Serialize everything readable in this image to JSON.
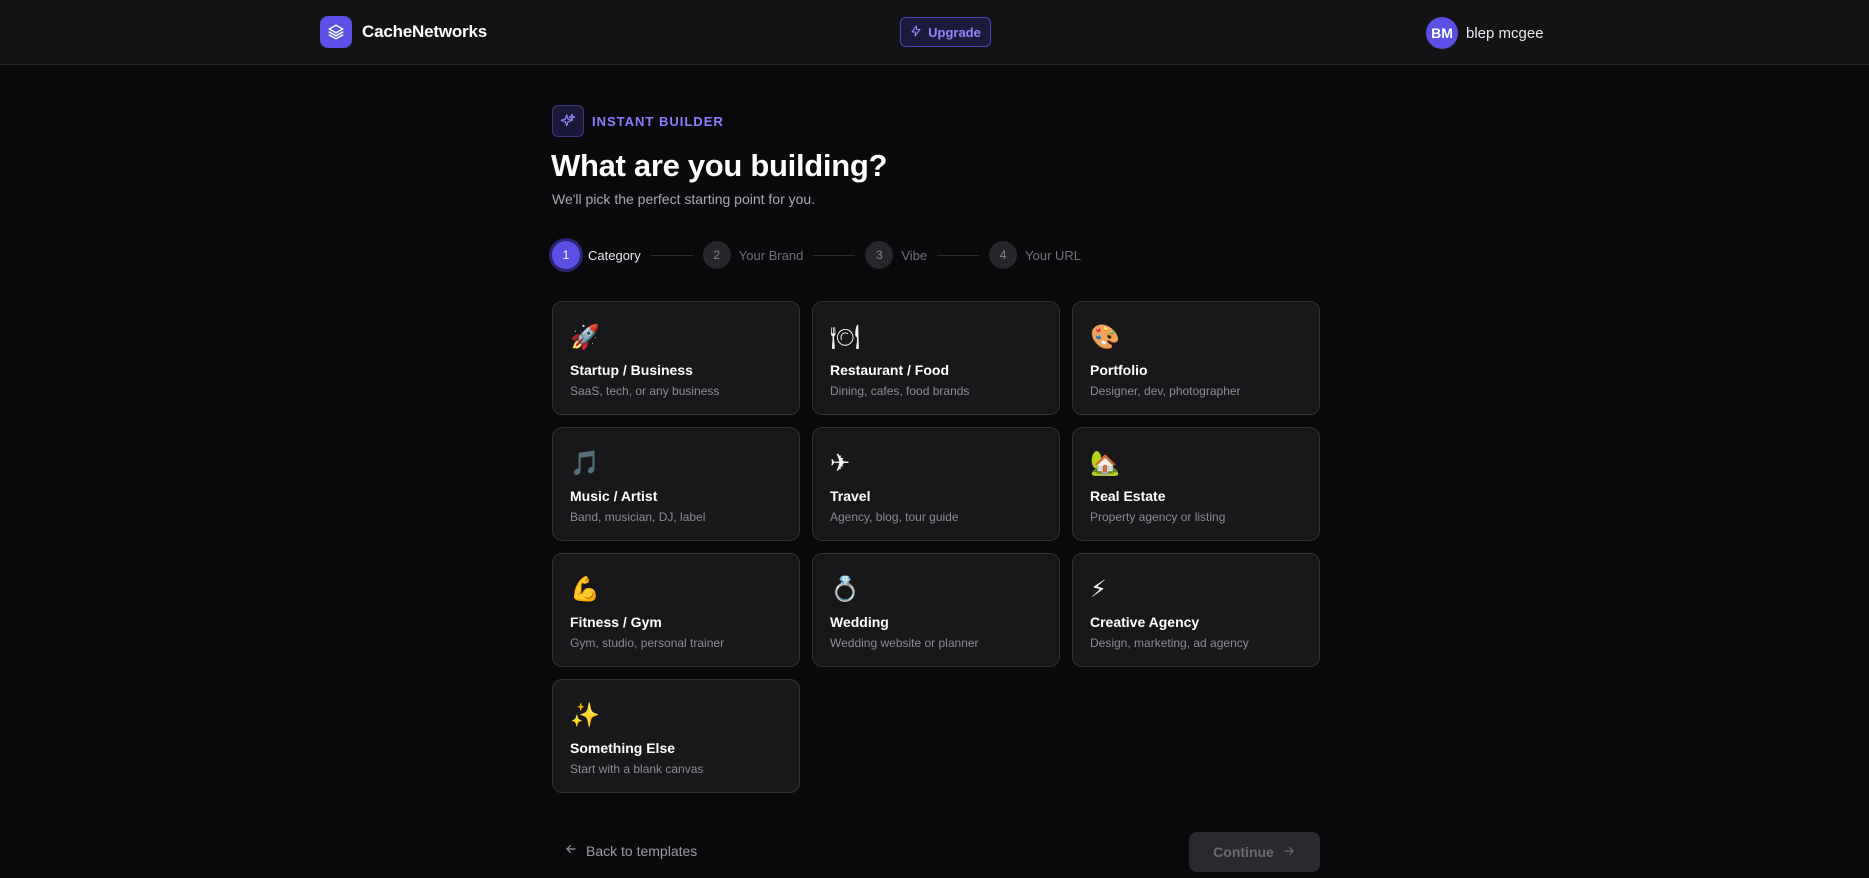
{
  "header": {
    "brand_name": "CacheNetworks",
    "logo_icon": "layers-icon",
    "upgrade_label": "Upgrade",
    "upgrade_icon": "lightning-icon",
    "user_initials": "BM",
    "user_name": "blep mcgee"
  },
  "builder": {
    "badge_icon": "sparkles-icon",
    "badge_label": "INSTANT BUILDER",
    "title": "What are you building?",
    "subtitle": "We'll pick the perfect starting point for you."
  },
  "steps": [
    {
      "number": "1",
      "label": "Category",
      "active": true
    },
    {
      "number": "2",
      "label": "Your Brand",
      "active": false
    },
    {
      "number": "3",
      "label": "Vibe",
      "active": false
    },
    {
      "number": "4",
      "label": "Your URL",
      "active": false
    }
  ],
  "categories": [
    {
      "icon": "🚀",
      "icon_name": "rocket-icon",
      "title": "Startup / Business",
      "description": "SaaS, tech, or any business"
    },
    {
      "icon": "🍽",
      "icon_name": "plate-icon",
      "title": "Restaurant / Food",
      "description": "Dining, cafes, food brands"
    },
    {
      "icon": "🎨",
      "icon_name": "palette-icon",
      "title": "Portfolio",
      "description": "Designer, dev, photographer"
    },
    {
      "icon": "🎵",
      "icon_name": "music-note-icon",
      "title": "Music / Artist",
      "description": "Band, musician, DJ, label"
    },
    {
      "icon": "✈",
      "icon_name": "airplane-icon",
      "title": "Travel",
      "description": "Agency, blog, tour guide"
    },
    {
      "icon": "🏡",
      "icon_name": "house-icon",
      "title": "Real Estate",
      "description": "Property agency or listing"
    },
    {
      "icon": "💪",
      "icon_name": "flexed-bicep-icon",
      "title": "Fitness / Gym",
      "description": "Gym, studio, personal trainer"
    },
    {
      "icon": "💍",
      "icon_name": "ring-icon",
      "title": "Wedding",
      "description": "Wedding website or planner"
    },
    {
      "icon": "⚡",
      "icon_name": "lightning-icon",
      "title": "Creative Agency",
      "description": "Design, marketing, ad agency"
    },
    {
      "icon": "✨",
      "icon_name": "sparkles-icon",
      "title": "Something Else",
      "description": "Start with a blank canvas"
    }
  ],
  "footer": {
    "back_label": "Back to templates",
    "continue_label": "Continue"
  },
  "colors": {
    "accent": "#5b4fe6",
    "accent_text": "#8a80ff",
    "background": "#0a0a0c",
    "card": "#18181b"
  }
}
